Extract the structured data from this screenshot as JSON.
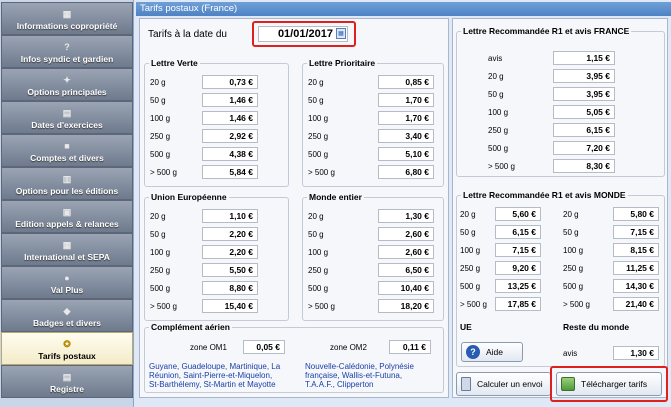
{
  "sidebar": {
    "items": [
      {
        "label": "Informations copropriété",
        "icon": "building-icon"
      },
      {
        "label": "Infos syndic et gardien",
        "icon": "help-icon"
      },
      {
        "label": "Options principales",
        "icon": "options-icon"
      },
      {
        "label": "Dates d'exercices",
        "icon": "calendar-icon"
      },
      {
        "label": "Comptes et divers",
        "icon": "accounts-icon"
      },
      {
        "label": "Options pour les éditions",
        "icon": "document-icon"
      },
      {
        "label": "Edition appels & relances",
        "icon": "print-icon"
      },
      {
        "label": "International et SEPA",
        "icon": "bank-icon"
      },
      {
        "label": "Val Plus",
        "icon": "globe-icon"
      },
      {
        "label": "Badges et divers",
        "icon": "badge-icon"
      },
      {
        "label": "Tarifs postaux",
        "icon": "stamp-icon"
      },
      {
        "label": "Registre",
        "icon": "registry-icon"
      }
    ],
    "active_index": 10
  },
  "header": {
    "title": "Tarifs postaux (France)"
  },
  "date": {
    "label": "Tarifs à la date du",
    "value": "01/01/2017"
  },
  "lettre_verte": {
    "title": "Lettre Verte",
    "rows": [
      [
        "20 g",
        "0,73 €"
      ],
      [
        "50 g",
        "1,46 €"
      ],
      [
        "100 g",
        "1,46 €"
      ],
      [
        "250 g",
        "2,92 €"
      ],
      [
        "500 g",
        "4,38 €"
      ],
      [
        "> 500 g",
        "5,84 €"
      ]
    ]
  },
  "lettre_prioritaire": {
    "title": "Lettre Prioritaire",
    "rows": [
      [
        "20 g",
        "0,85 €"
      ],
      [
        "50 g",
        "1,70 €"
      ],
      [
        "100 g",
        "1,70 €"
      ],
      [
        "250 g",
        "3,40 €"
      ],
      [
        "500 g",
        "5,10 €"
      ],
      [
        "> 500 g",
        "6,80 €"
      ]
    ]
  },
  "union_europeenne": {
    "title": "Union Européenne",
    "rows": [
      [
        "20 g",
        "1,10 €"
      ],
      [
        "50 g",
        "2,20 €"
      ],
      [
        "100 g",
        "2,20 €"
      ],
      [
        "250 g",
        "5,50 €"
      ],
      [
        "500 g",
        "8,80 €"
      ],
      [
        "> 500 g",
        "15,40 €"
      ]
    ]
  },
  "monde_entier": {
    "title": "Monde entier",
    "rows": [
      [
        "20 g",
        "1,30 €"
      ],
      [
        "50 g",
        "2,60 €"
      ],
      [
        "100 g",
        "2,60 €"
      ],
      [
        "250 g",
        "6,50 €"
      ],
      [
        "500 g",
        "10,40 €"
      ],
      [
        "> 500 g",
        "18,20 €"
      ]
    ]
  },
  "complement": {
    "title": "Complément aérien",
    "om1_label": "zone OM1",
    "om1_value": "0,05 €",
    "om2_label": "zone OM2",
    "om2_value": "0,11 €",
    "om1_desc": [
      "Guyane, Guadeloupe, Martinique, La",
      "Réunion, Saint-Pierre-et-Miquelon,",
      "St-Barthélemy, St-Martin et Mayotte"
    ],
    "om2_desc": [
      "Nouvelle-Calédonie, Polynésie",
      "française, Wallis-et-Futuna,",
      "T.A.A.F., Clipperton"
    ]
  },
  "r1_france": {
    "title": "Lettre Recommandée R1 et avis FRANCE",
    "rows": [
      [
        "avis",
        "1,15 €"
      ],
      [
        "20 g",
        "3,95 €"
      ],
      [
        "50 g",
        "3,95 €"
      ],
      [
        "100 g",
        "5,05 €"
      ],
      [
        "250 g",
        "6,15 €"
      ],
      [
        "500 g",
        "7,20 €"
      ],
      [
        "> 500 g",
        "8,30 €"
      ]
    ]
  },
  "r1_monde": {
    "title": "Lettre Recommandée R1 et avis MONDE",
    "ue_rows": [
      [
        "20 g",
        "5,60 €"
      ],
      [
        "50 g",
        "6,15 €"
      ],
      [
        "100 g",
        "7,15 €"
      ],
      [
        "250 g",
        "9,20 €"
      ],
      [
        "500 g",
        "13,25 €"
      ],
      [
        "> 500 g",
        "17,85 €"
      ]
    ],
    "rdm_rows": [
      [
        "20 g",
        "5,80 €"
      ],
      [
        "50 g",
        "7,15 €"
      ],
      [
        "100 g",
        "8,15 €"
      ],
      [
        "250 g",
        "11,25 €"
      ],
      [
        "500 g",
        "14,30 €"
      ],
      [
        "> 500 g",
        "21,40 €"
      ]
    ],
    "ue_label": "UE",
    "rdm_label": "Reste du monde",
    "avis_label": "avis",
    "avis_value": "1,30 €"
  },
  "buttons": {
    "aide": "Aide",
    "calculer": "Calculer un envoi",
    "telecharger": "Télécharger tarifs"
  }
}
